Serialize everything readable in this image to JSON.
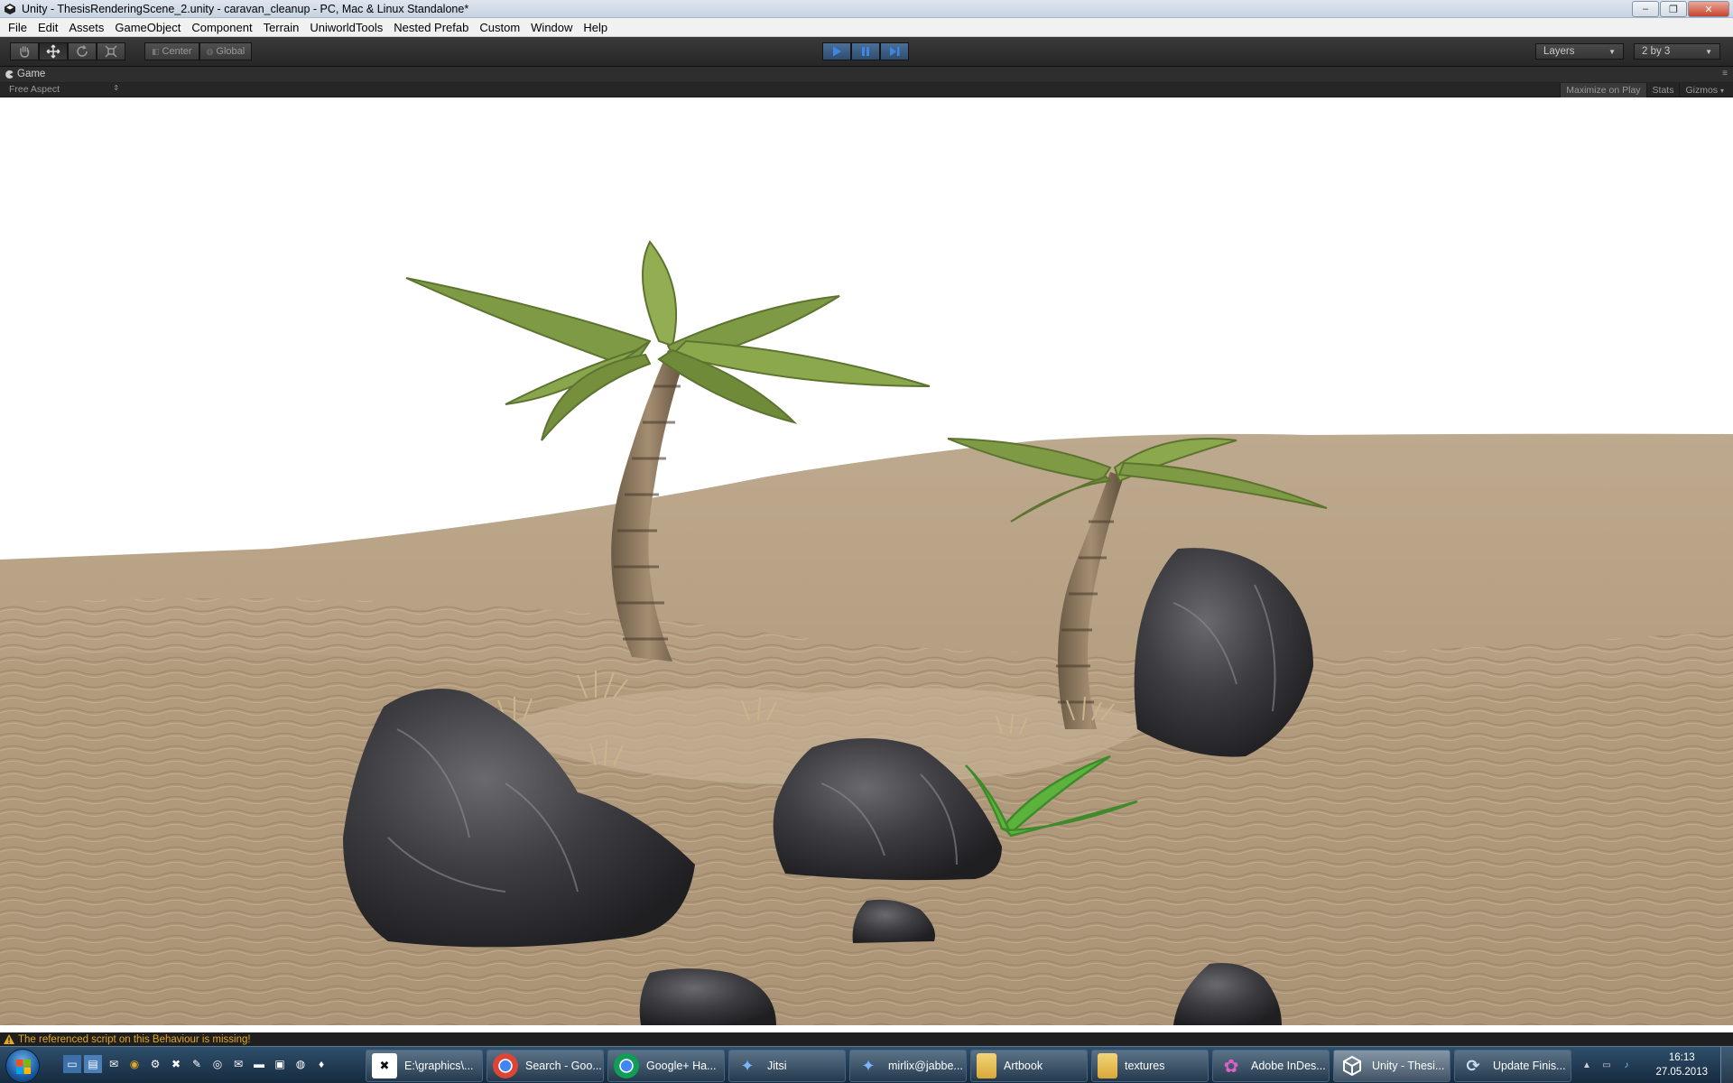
{
  "window": {
    "title": "Unity - ThesisRenderingScene_2.unity - caravan_cleanup - PC, Mac & Linux Standalone*",
    "controls": {
      "minimize": "–",
      "maximize": "❐",
      "close": "✕"
    }
  },
  "menu": [
    "File",
    "Edit",
    "Assets",
    "GameObject",
    "Component",
    "Terrain",
    "UniworldTools",
    "Nested Prefab",
    "Custom",
    "Window",
    "Help"
  ],
  "toolbar": {
    "transform_tools": [
      "hand-icon",
      "move-icon",
      "rotate-icon",
      "scale-icon"
    ],
    "pivot_mode": "Center",
    "pivot_rotation": "Global",
    "play_controls": [
      "play-icon",
      "pause-icon",
      "step-icon"
    ],
    "layers_label": "Layers",
    "layout_label": "2 by 3",
    "accent_color": "#3e6290"
  },
  "game_panel": {
    "tab_label": "Game",
    "aspect": "Free Aspect",
    "controls": [
      "Maximize on Play",
      "Stats",
      "Gizmos"
    ]
  },
  "viewport": {
    "sky_color": "#ffffff",
    "sand_color": "#b8a285",
    "rock_color": "#3a3a3c"
  },
  "status": {
    "message": "The referenced script on this Behaviour is missing!",
    "color": "#e6a81f"
  },
  "taskbar": {
    "tasks": [
      {
        "label": "E:\\graphics\\...",
        "icon": "xnview-icon"
      },
      {
        "label": "Search - Goo...",
        "icon": "chrome-icon"
      },
      {
        "label": "Google+ Ha...",
        "icon": "chrome-icon"
      },
      {
        "label": "Jitsi",
        "icon": "jitsi-icon"
      },
      {
        "label": "mirlix@jabbe...",
        "icon": "jitsi-icon"
      },
      {
        "label": "Artbook",
        "icon": "folder-icon"
      },
      {
        "label": "textures",
        "icon": "folder-icon"
      },
      {
        "label": "Adobe InDes...",
        "icon": "indesign-icon"
      },
      {
        "label": "Unity - Thesi...",
        "icon": "unity-icon"
      },
      {
        "label": "Update Finis...",
        "icon": "updater-icon"
      }
    ],
    "clock_time": "16:13",
    "clock_date": "27.05.2013"
  }
}
